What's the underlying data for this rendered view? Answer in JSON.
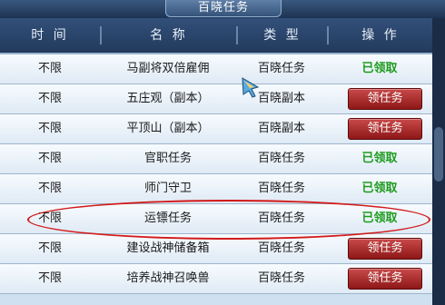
{
  "window": {
    "title": "百晓任务"
  },
  "headers": {
    "time": "时 间",
    "name": "名 称",
    "type": "类 型",
    "action": "操 作"
  },
  "rows": [
    {
      "time": "不限",
      "name": "马副将双倍雇佣",
      "type": "百晓任务",
      "action": "已领取",
      "action_kind": "taken"
    },
    {
      "time": "不限",
      "name": "五庄观（副本）",
      "type": "百晓副本",
      "action": "领任务",
      "action_kind": "button"
    },
    {
      "time": "不限",
      "name": "平顶山（副本）",
      "type": "百晓副本",
      "action": "领任务",
      "action_kind": "button"
    },
    {
      "time": "不限",
      "name": "官职任务",
      "type": "百晓任务",
      "action": "已领取",
      "action_kind": "taken"
    },
    {
      "time": "不限",
      "name": "师门守卫",
      "type": "百晓任务",
      "action": "已领取",
      "action_kind": "taken"
    },
    {
      "time": "不限",
      "name": "运镖任务",
      "type": "百晓任务",
      "action": "已领取",
      "action_kind": "taken"
    },
    {
      "time": "不限",
      "name": "建设战神储备箱",
      "type": "百晓任务",
      "action": "领任务",
      "action_kind": "button"
    },
    {
      "time": "不限",
      "name": "培养战神召唤兽",
      "type": "百晓任务",
      "action": "领任务",
      "action_kind": "button"
    }
  ],
  "colors": {
    "taken": "#1e9b1e",
    "button_bg": "#a52222",
    "annotation": "#d21a1a"
  },
  "icons": {
    "cursor": "cursor-icon"
  }
}
